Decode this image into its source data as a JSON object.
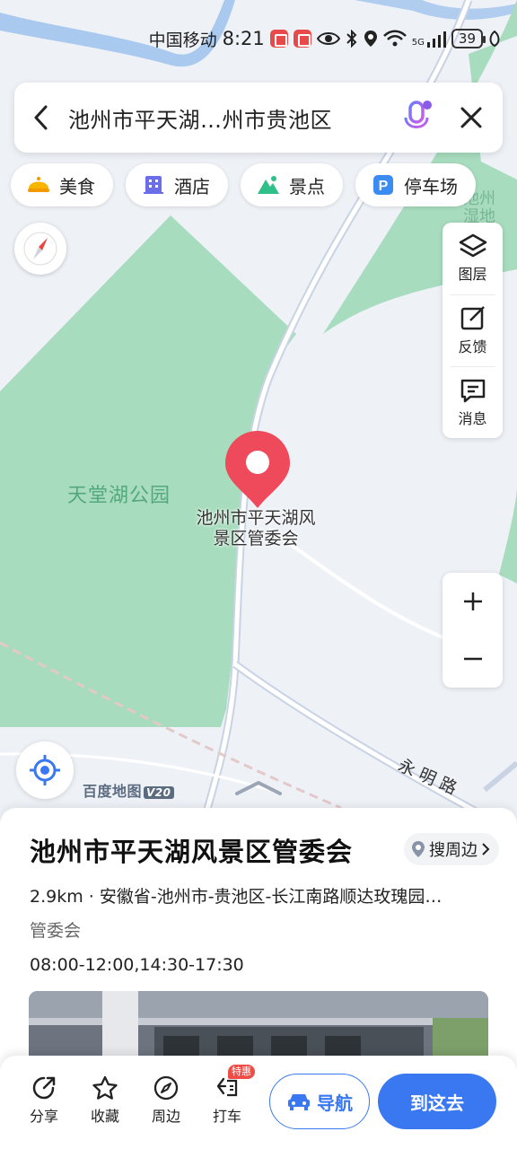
{
  "status_bar": {
    "carrier": "中国移动",
    "time": "8:21",
    "network": "5G",
    "battery": "39"
  },
  "search": {
    "query": "池州市平天湖…州市贵池区"
  },
  "categories": [
    {
      "label": "美食",
      "icon": "food-icon"
    },
    {
      "label": "酒店",
      "icon": "hotel-icon"
    },
    {
      "label": "景点",
      "icon": "scenic-icon"
    },
    {
      "label": "停车场",
      "icon": "parking-icon"
    }
  ],
  "tools": {
    "layers": "图层",
    "feedback": "反馈",
    "messages": "消息"
  },
  "map": {
    "park_label": "天堂湖公园",
    "poi_label_line1": "池州市平天湖风",
    "poi_label_line2": "景区管委会",
    "road_label": "永明路",
    "edge_label": "池州\n湿地",
    "logo": "百度地图",
    "logo_version": "V20"
  },
  "poi": {
    "name": "池州市平天湖风景区管委会",
    "nearby_label": "搜周边",
    "address": "2.9km · 安徽省-池州市-贵池区-长江南路顺达玫瑰园…",
    "category": "管委会",
    "hours": "08:00-12:00,14:30-17:30"
  },
  "actions": {
    "share": "分享",
    "favorite": "收藏",
    "nearby": "周边",
    "taxi": "打车",
    "taxi_badge": "特惠",
    "navigate": "导航",
    "go_here": "到这去"
  },
  "colors": {
    "accent": "#3a78f2",
    "park_green": "#a8dcbe",
    "pin_red": "#ee4a5b"
  }
}
